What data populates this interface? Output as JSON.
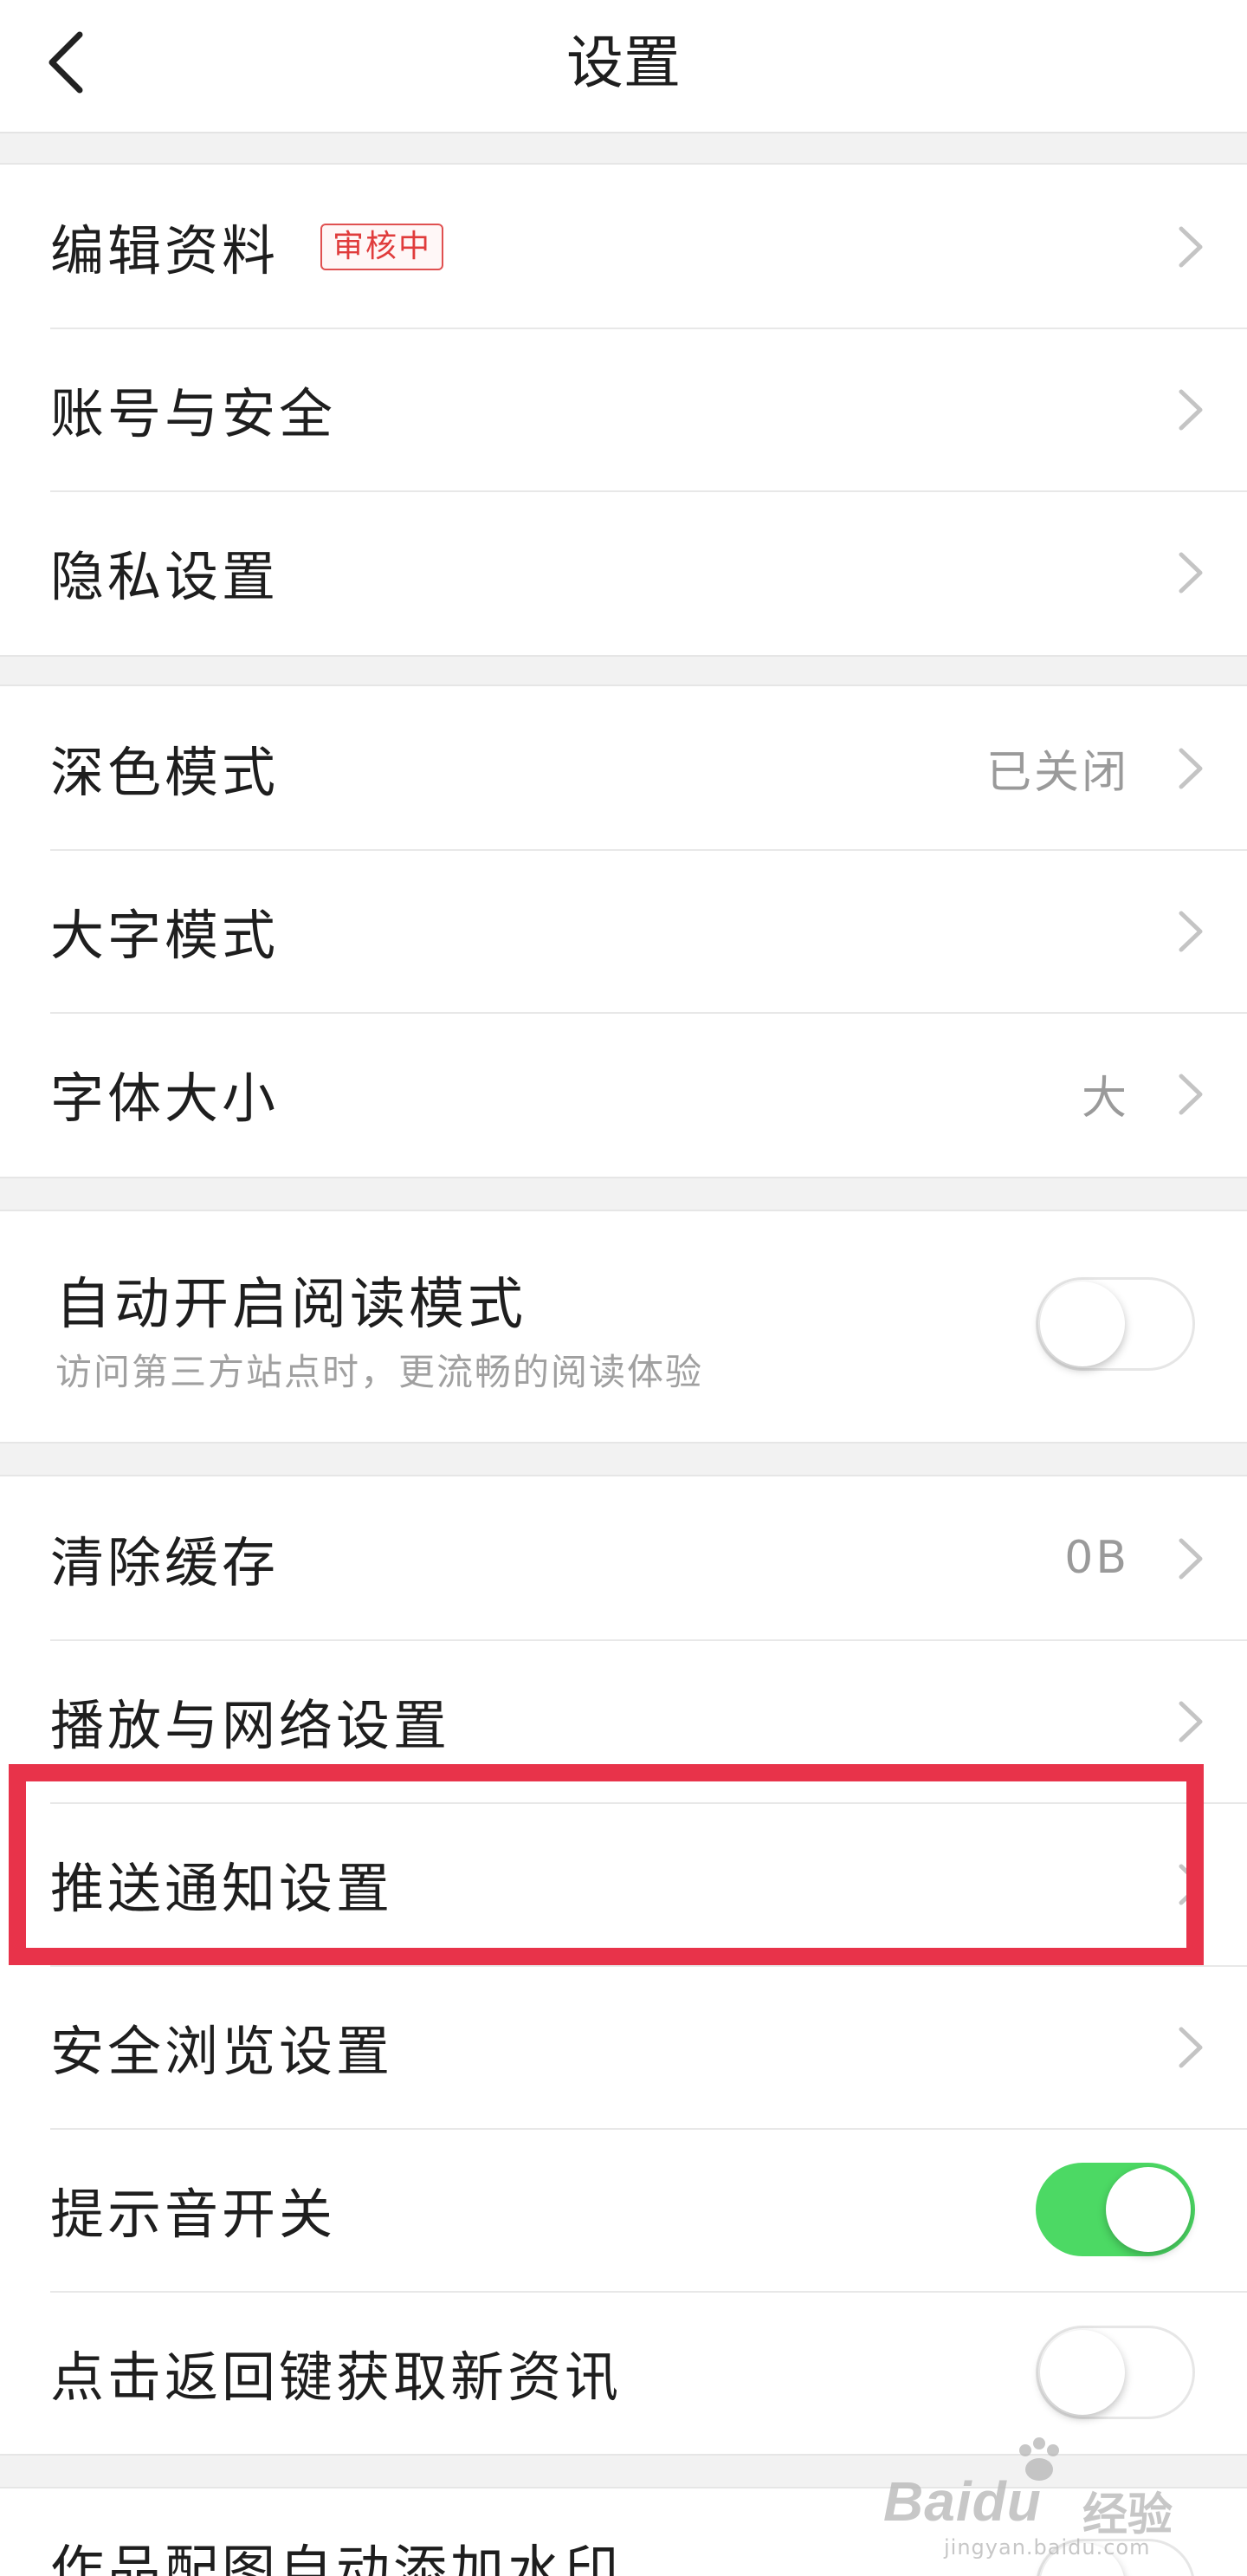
{
  "header": {
    "title": "设置"
  },
  "group1": {
    "items": [
      {
        "label": "编辑资料",
        "badge": "审核中"
      },
      {
        "label": "账号与安全"
      },
      {
        "label": "隐私设置"
      }
    ]
  },
  "group2": {
    "items": [
      {
        "label": "深色模式",
        "value": "已关闭"
      },
      {
        "label": "大字模式"
      },
      {
        "label": "字体大小",
        "value": "大"
      }
    ]
  },
  "group3": {
    "label": "自动开启阅读模式",
    "sublabel": "访问第三方站点时，更流畅的阅读体验",
    "toggle": false
  },
  "group4": {
    "items": [
      {
        "label": "清除缓存",
        "value": "0B"
      },
      {
        "label": "播放与网络设置"
      },
      {
        "label": "推送通知设置"
      },
      {
        "label": "安全浏览设置"
      },
      {
        "label": "提示音开关",
        "toggle": true
      },
      {
        "label": "点击返回键获取新资讯",
        "toggle": false
      }
    ]
  },
  "group5": {
    "label": "作品配图自动添加水印"
  },
  "watermark": {
    "brand": "Baidu",
    "cn": "经验",
    "url": "jingyan.baidu.com"
  },
  "colors": {
    "highlight": "#e8334a",
    "toggle_on": "#4cd964",
    "badge": "#e03c3c"
  },
  "icons": {
    "back": "chevron-left-icon",
    "row": "chevron-right-icon"
  }
}
